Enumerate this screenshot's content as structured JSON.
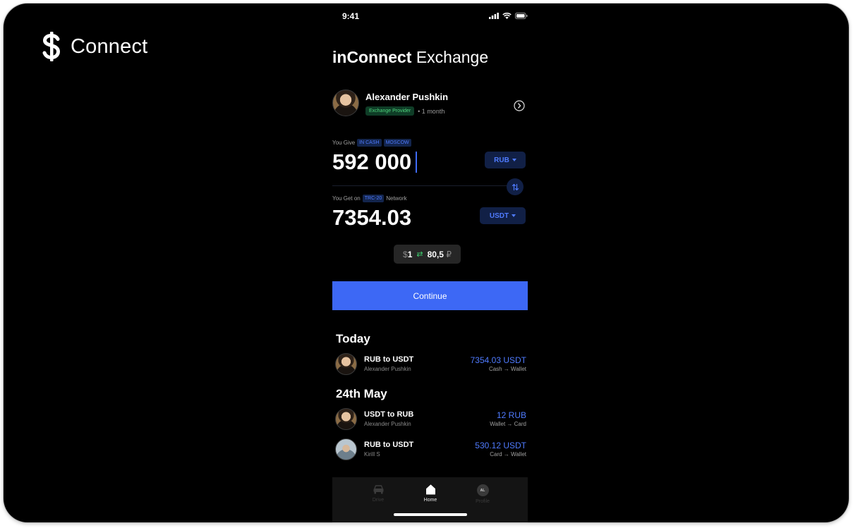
{
  "brand": {
    "name": "Connect",
    "logo_icon": "dollar-icon"
  },
  "status_bar": {
    "time": "9:41"
  },
  "header": {
    "title_bold": "inConnect",
    "title_rest": " Exchange"
  },
  "provider": {
    "name": "Alexander Pushkin",
    "badge": "Exchange Provider",
    "meta": "• 1 month"
  },
  "give": {
    "label": "You Give",
    "tags": [
      "IN CASH",
      "MOSCOW"
    ],
    "amount": "592 000",
    "currency": "RUB"
  },
  "get": {
    "label": "You Get on",
    "network_tag": "TRC-20",
    "network_word": "Network",
    "amount": "7354.03",
    "currency": "USDT"
  },
  "rate": {
    "left_symbol": "$",
    "left_value": "1",
    "swap_icon": "⇄",
    "right_value": "80,5",
    "right_symbol": "₽"
  },
  "continue_label": "Continue",
  "sections": [
    {
      "title": "Today",
      "items": [
        {
          "title": "RUB to USDT",
          "subtitle": "Alexander Pushkin",
          "amount": "7354.03 USDT",
          "flow": "Cash → Wallet"
        }
      ]
    },
    {
      "title": "24th May",
      "items": [
        {
          "title": "USDT to RUB",
          "subtitle": "Alexander Pushkin",
          "amount": "12 RUB",
          "flow": "Wallet → Card"
        },
        {
          "title": "RUB to USDT",
          "subtitle": "Kirill S",
          "amount": "530.12 USDT",
          "flow": "Card → Wallet"
        }
      ]
    }
  ],
  "tabbar": {
    "drive": "Drive",
    "home": "Home",
    "profile": "Profile",
    "profile_initials": "AL"
  },
  "colors": {
    "accent": "#3d68f5",
    "link_blue": "#4f7bff",
    "green": "#4fd67e",
    "background": "#000000"
  }
}
